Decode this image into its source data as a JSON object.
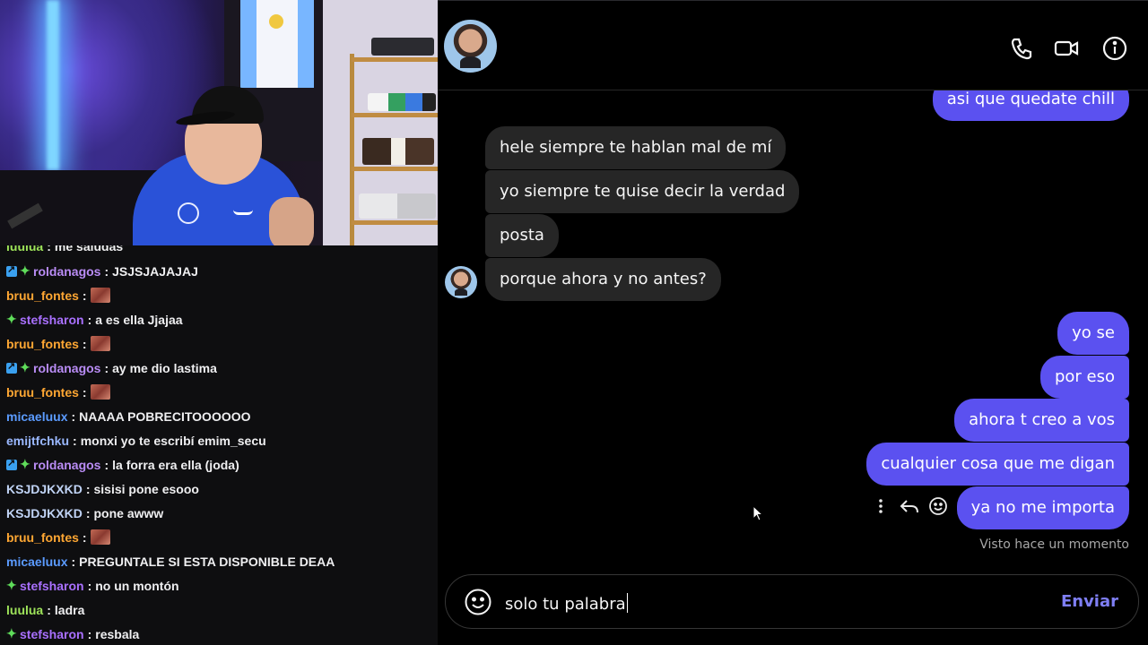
{
  "chat": {
    "messages": [
      {
        "badges": [],
        "user": "luulua",
        "color": "#9ee35a",
        "text": "me saludas",
        "emote": false
      },
      {
        "badges": [
          "prime",
          "spark"
        ],
        "user": "roldanagos",
        "color": "#b98cf5",
        "text": "JSJSJAJAJAJ",
        "emote": false
      },
      {
        "badges": [],
        "user": "bruu_fontes",
        "color": "#ffa733",
        "text": "",
        "emote": true
      },
      {
        "badges": [
          "spark"
        ],
        "user": "stefsharon",
        "color": "#a970ff",
        "text": "a es ella Jjajaa",
        "emote": false
      },
      {
        "badges": [],
        "user": "bruu_fontes",
        "color": "#ffa733",
        "text": "",
        "emote": true
      },
      {
        "badges": [
          "prime",
          "spark"
        ],
        "user": "roldanagos",
        "color": "#b98cf5",
        "text": "ay me dio lastima",
        "emote": false
      },
      {
        "badges": [],
        "user": "bruu_fontes",
        "color": "#ffa733",
        "text": "",
        "emote": true
      },
      {
        "badges": [],
        "user": "micaeluux",
        "color": "#5b9bff",
        "text": "NAAAA POBRECITOOOOOO",
        "emote": false
      },
      {
        "badges": [],
        "user": "emijtfchku",
        "color": "#9ab8ff",
        "text": "monxi yo te escribí emim_secu",
        "emote": false
      },
      {
        "badges": [
          "prime",
          "spark"
        ],
        "user": "roldanagos",
        "color": "#b98cf5",
        "text": "la forra era ella (joda)",
        "emote": false
      },
      {
        "badges": [],
        "user": "KSJDJKXKD",
        "color": "#c0d3f5",
        "text": "sisisi pone esooo",
        "emote": false
      },
      {
        "badges": [],
        "user": "KSJDJKXKD",
        "color": "#c0d3f5",
        "text": "pone awww",
        "emote": false
      },
      {
        "badges": [],
        "user": "bruu_fontes",
        "color": "#ffa733",
        "text": "",
        "emote": true
      },
      {
        "badges": [],
        "user": "micaeluux",
        "color": "#5b9bff",
        "text": "PREGUNTALE SI ESTA DISPONIBLE DEAA",
        "emote": false
      },
      {
        "badges": [
          "spark"
        ],
        "user": "stefsharon",
        "color": "#a970ff",
        "text": "no un montón",
        "emote": false
      },
      {
        "badges": [],
        "user": "luulua",
        "color": "#9ee35a",
        "text": "ladra",
        "emote": false
      },
      {
        "badges": [
          "spark"
        ],
        "user": "stefsharon",
        "color": "#a970ff",
        "text": "resbala",
        "emote": false
      }
    ]
  },
  "dm": {
    "header_icons": [
      "phone-icon",
      "video-icon",
      "info-icon"
    ],
    "incoming": [
      "hele siempre te hablan mal de mí",
      "yo siempre te quise decir la verdad",
      "posta",
      "porque ahora y no antes?"
    ],
    "outgoing_top": "asi que quedate chill",
    "outgoing": [
      "yo se",
      "por eso",
      "ahora t creo a vos",
      "cualquier cosa que me digan",
      "ya no me importa"
    ],
    "seen": "Visto hace un momento",
    "composer": {
      "text": "solo tu palabra",
      "send_label": "Enviar"
    },
    "colors": {
      "outgoing_bubble": "#5b51f0",
      "incoming_bubble": "#262626",
      "send": "#7f7ff5"
    }
  }
}
